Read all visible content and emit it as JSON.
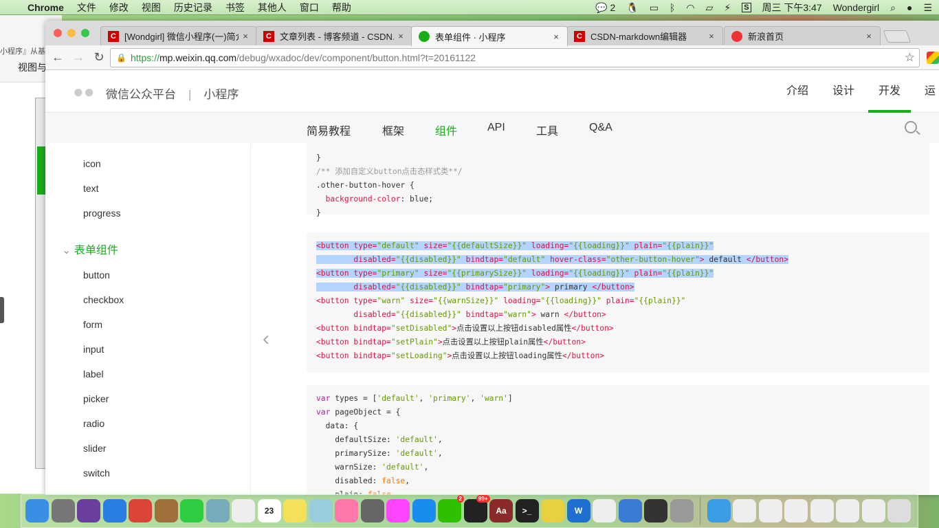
{
  "menubar": {
    "app": "Chrome",
    "items": [
      "文件",
      "修改",
      "视图",
      "历史记录",
      "书签",
      "其他人",
      "窗口",
      "帮助"
    ],
    "wechat_count": "2",
    "clock": "周三 下午3:47",
    "user": "Wondergirl"
  },
  "background_window": {
    "text1": "小程序』从基础",
    "text2": "视图与"
  },
  "tabs": [
    {
      "title": "[Wondgirl] 微信小程序(一)简介",
      "icon": "csdn-icon",
      "color": "#c00"
    },
    {
      "title": "文章列表 - 博客频道 - CSDN.NET",
      "icon": "csdn-icon",
      "color": "#c00"
    },
    {
      "title": "表单组件 · 小程序",
      "icon": "wechat-icon",
      "color": "#1aad19"
    },
    {
      "title": "CSDN-markdown编辑器",
      "icon": "csdn-icon",
      "color": "#c00"
    },
    {
      "title": "新浪首页",
      "icon": "weibo-icon",
      "color": "#e33"
    }
  ],
  "address": {
    "scheme": "https://",
    "host": "mp.weixin.qq.com",
    "path": "/debug/wxadoc/dev/component/button.html?t=20161122"
  },
  "header": {
    "brand": "微信公众平台",
    "separator": "|",
    "product": "小程序",
    "nav": [
      "介绍",
      "设计",
      "开发",
      "运营"
    ],
    "active_nav": "开发"
  },
  "subnav": {
    "items": [
      "简易教程",
      "框架",
      "组件",
      "API",
      "工具",
      "Q&A"
    ],
    "active": "组件"
  },
  "sidebar": {
    "items_top": [
      "icon",
      "text",
      "progress"
    ],
    "group": "表单组件",
    "items": [
      "button",
      "checkbox",
      "form",
      "input",
      "label",
      "picker",
      "radio",
      "slider",
      "switch"
    ]
  },
  "code_blocks": [
    {
      "lines": [
        {
          "t": [
            [
              "p",
              "}"
            ]
          ]
        },
        {
          "t": [
            [
              "c",
              "/** 添加自定义button点击态样式类**/"
            ]
          ]
        },
        {
          "t": [
            [
              "p",
              ".other-button-hover {"
            ]
          ]
        },
        {
          "t": [
            [
              "p",
              "  "
            ],
            [
              "k",
              "background-color"
            ],
            [
              "p",
              ": blue;"
            ]
          ]
        },
        {
          "t": [
            [
              "p",
              "}"
            ]
          ]
        }
      ]
    },
    {
      "lines": [
        {
          "sel": true,
          "t": [
            [
              "k",
              "<button "
            ],
            [
              "k",
              "type="
            ],
            [
              "s",
              "\"default\""
            ],
            [
              "k",
              " size="
            ],
            [
              "s",
              "\"{{defaultSize}}\""
            ],
            [
              "k",
              " loading="
            ],
            [
              "s",
              "\"{{loading}}\""
            ],
            [
              "k",
              " plain="
            ],
            [
              "s",
              "\"{{plain}}\""
            ]
          ]
        },
        {
          "sel": true,
          "t": [
            [
              "p",
              "        "
            ],
            [
              "k",
              "disabled="
            ],
            [
              "s",
              "\"{{disabled}}\""
            ],
            [
              "k",
              " bindtap="
            ],
            [
              "s",
              "\"default\""
            ],
            [
              "k",
              " hover-class="
            ],
            [
              "s",
              "\"other-button-hover\""
            ],
            [
              "k",
              ">"
            ],
            [
              "p",
              " default "
            ],
            [
              "k",
              "</button>"
            ]
          ]
        },
        {
          "sel": true,
          "t": [
            [
              "k",
              "<button "
            ],
            [
              "k",
              "type="
            ],
            [
              "s",
              "\"primary\""
            ],
            [
              "k",
              " size="
            ],
            [
              "s",
              "\"{{primarySize}}\""
            ],
            [
              "k",
              " loading="
            ],
            [
              "s",
              "\"{{loading}}\""
            ],
            [
              "k",
              " plain="
            ],
            [
              "s",
              "\"{{plain}}\""
            ]
          ]
        },
        {
          "sel": true,
          "t": [
            [
              "p",
              "        "
            ],
            [
              "k",
              "disabled="
            ],
            [
              "s",
              "\"{{disabled}}\""
            ],
            [
              "k",
              " bindtap="
            ],
            [
              "s",
              "\"primary\""
            ],
            [
              "k",
              ">"
            ],
            [
              "p",
              " primary "
            ],
            [
              "k",
              "</button>"
            ]
          ]
        },
        {
          "t": [
            [
              "k",
              "<button "
            ],
            [
              "k",
              "type="
            ],
            [
              "s",
              "\"warn\""
            ],
            [
              "k",
              " size="
            ],
            [
              "s",
              "\"{{warnSize}}\""
            ],
            [
              "k",
              " loading="
            ],
            [
              "s",
              "\"{{loading}}\""
            ],
            [
              "k",
              " plain="
            ],
            [
              "s",
              "\"{{plain}}\""
            ]
          ]
        },
        {
          "t": [
            [
              "p",
              "        "
            ],
            [
              "k",
              "disabled="
            ],
            [
              "s",
              "\"{{disabled}}\""
            ],
            [
              "k",
              " bindtap="
            ],
            [
              "s",
              "\"warn\""
            ],
            [
              "k",
              ">"
            ],
            [
              "p",
              " warn "
            ],
            [
              "k",
              "</button>"
            ]
          ]
        },
        {
          "t": [
            [
              "k",
              "<button "
            ],
            [
              "k",
              "bindtap="
            ],
            [
              "s",
              "\"setDisabled\""
            ],
            [
              "k",
              ">"
            ],
            [
              "p",
              "点击设置以上按钮disabled属性"
            ],
            [
              "k",
              "</button>"
            ]
          ]
        },
        {
          "t": [
            [
              "k",
              "<button "
            ],
            [
              "k",
              "bindtap="
            ],
            [
              "s",
              "\"setPlain\""
            ],
            [
              "k",
              ">"
            ],
            [
              "p",
              "点击设置以上按钮plain属性"
            ],
            [
              "k",
              "</button>"
            ]
          ]
        },
        {
          "t": [
            [
              "k",
              "<button "
            ],
            [
              "k",
              "bindtap="
            ],
            [
              "s",
              "\"setLoading\""
            ],
            [
              "k",
              ">"
            ],
            [
              "p",
              "点击设置以上按钮loading属性"
            ],
            [
              "k",
              "</button>"
            ]
          ]
        }
      ]
    },
    {
      "lines": [
        {
          "t": [
            [
              "v",
              "var"
            ],
            [
              "p",
              " types = ["
            ],
            [
              "s",
              "'default'"
            ],
            [
              "p",
              ", "
            ],
            [
              "s",
              "'primary'"
            ],
            [
              "p",
              ", "
            ],
            [
              "s",
              "'warn'"
            ],
            [
              "p",
              "]"
            ]
          ]
        },
        {
          "t": [
            [
              "v",
              "var"
            ],
            [
              "p",
              " pageObject = {"
            ]
          ]
        },
        {
          "t": [
            [
              "p",
              "  data: {"
            ]
          ]
        },
        {
          "t": [
            [
              "p",
              "    defaultSize: "
            ],
            [
              "s",
              "'default'"
            ],
            [
              "p",
              ","
            ]
          ]
        },
        {
          "t": [
            [
              "p",
              "    primarySize: "
            ],
            [
              "s",
              "'default'"
            ],
            [
              "p",
              ","
            ]
          ]
        },
        {
          "t": [
            [
              "p",
              "    warnSize: "
            ],
            [
              "s",
              "'default'"
            ],
            [
              "p",
              ","
            ]
          ]
        },
        {
          "t": [
            [
              "p",
              "    disabled: "
            ],
            [
              "b",
              "false"
            ],
            [
              "p",
              ","
            ]
          ]
        },
        {
          "t": [
            [
              "p",
              "    plain: "
            ],
            [
              "b",
              "false"
            ],
            [
              "p",
              ","
            ]
          ]
        }
      ]
    }
  ],
  "dock": [
    {
      "name": "finder",
      "color": "#3a8ee6"
    },
    {
      "name": "launchpad",
      "color": "#777"
    },
    {
      "name": "siri",
      "color": "#6a3fa0"
    },
    {
      "name": "safari",
      "color": "#2a7de1"
    },
    {
      "name": "chrome",
      "color": "#db4437"
    },
    {
      "name": "contacts",
      "color": "#a0703a"
    },
    {
      "name": "facetime",
      "color": "#2ecc40"
    },
    {
      "name": "mail",
      "color": "#7ab"
    },
    {
      "name": "reminders",
      "color": "#eee"
    },
    {
      "name": "calendar",
      "color": "#fff",
      "label": "23"
    },
    {
      "name": "notes",
      "color": "#f5e05a"
    },
    {
      "name": "maps",
      "color": "#9cd"
    },
    {
      "name": "photos",
      "color": "#f7a"
    },
    {
      "name": "system-preferences",
      "color": "#666"
    },
    {
      "name": "itunes",
      "color": "#f4f"
    },
    {
      "name": "app-store",
      "color": "#1a8cf0"
    },
    {
      "name": "wechat",
      "color": "#2dc100",
      "badge": "2"
    },
    {
      "name": "qq",
      "color": "#222",
      "badge": "99+"
    },
    {
      "name": "dictionary",
      "color": "#8b2a2a",
      "label": "Aa"
    },
    {
      "name": "terminal",
      "color": "#222",
      "label": ">_"
    },
    {
      "name": "wonderful-app",
      "color": "#e8d040"
    },
    {
      "name": "word",
      "color": "#1e6fd0",
      "label": "W"
    },
    {
      "name": "textedit",
      "color": "#eee"
    },
    {
      "name": "xcode",
      "color": "#3a7bd5"
    },
    {
      "name": "console",
      "color": "#333"
    },
    {
      "name": "keyboard",
      "color": "#999"
    }
  ],
  "dock_right": [
    {
      "name": "folder",
      "color": "#3a9be6"
    },
    {
      "name": "window-thumb-1",
      "color": "#eee"
    },
    {
      "name": "window-thumb-2",
      "color": "#eee"
    },
    {
      "name": "window-thumb-3",
      "color": "#eee"
    },
    {
      "name": "window-thumb-4",
      "color": "#eee"
    },
    {
      "name": "window-thumb-5",
      "color": "#eee"
    },
    {
      "name": "window-thumb-6",
      "color": "#eee"
    },
    {
      "name": "trash",
      "color": "#ddd"
    }
  ]
}
